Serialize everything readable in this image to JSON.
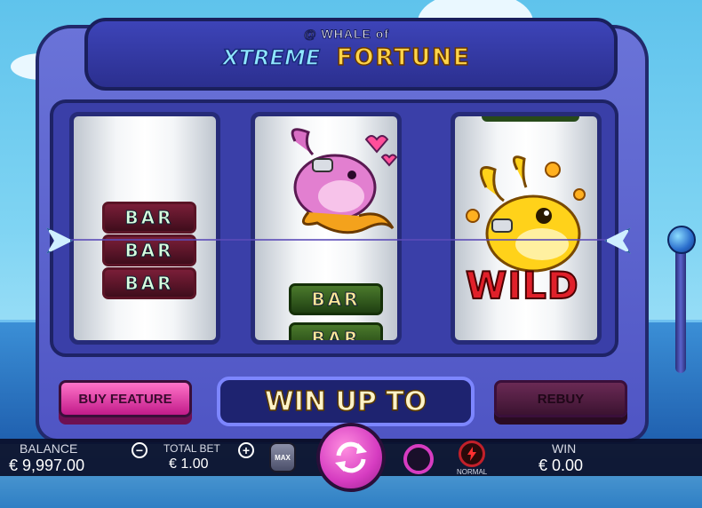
{
  "logo": {
    "line1": "@ WHALE of",
    "word1": "XTREME",
    "word2": "FORTUNE"
  },
  "reels": {
    "reel1": {
      "symbols": [
        "BAR",
        "BAR",
        "BAR"
      ]
    },
    "reel2": {
      "symbols": [
        "pink-whale",
        "BAR",
        "BAR"
      ]
    },
    "reel3": {
      "symbols": [
        "golden-whale-wild"
      ],
      "wild_label": "WILD"
    }
  },
  "buttons": {
    "buy_feature": "BUY FEATURE",
    "rebuy": "REBUY"
  },
  "banner": {
    "text": "WIN UP TO"
  },
  "hud": {
    "balance_label": "BALANCE",
    "balance_value": "€ 9,997.00",
    "total_bet_label": "TOTAL BET",
    "total_bet_value": "€ 1.00",
    "minus": "−",
    "plus": "+",
    "max_label": "MAX",
    "speed_label": "NORMAL",
    "win_label": "WIN",
    "win_value": "€ 0.00"
  },
  "colors": {
    "cabinet": "#5a61cf",
    "spin_button": "#d63cc1",
    "buy_feature": "#e23aa6",
    "rebuy": "#4c1a40"
  }
}
